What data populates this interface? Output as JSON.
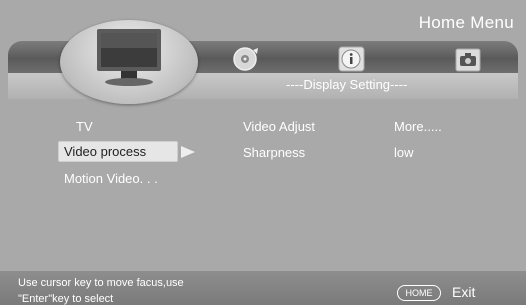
{
  "header": {
    "title": "Home  Menu"
  },
  "section": {
    "title": "----Display Setting----"
  },
  "top_icons": [
    "tv-icon",
    "disc-icon",
    "info-icon",
    "camera-icon"
  ],
  "menu": {
    "col1": [
      "TV",
      "Video  process",
      "Motion  Video. . ."
    ],
    "col2": [
      "Video  Adjust",
      "Sharpness"
    ],
    "col3": [
      "More.....",
      "low"
    ]
  },
  "footer": {
    "hint_line1": "Use cursor key to move facus,use",
    "hint_line2": "\"Enter\"key to select",
    "home_button": "HOME",
    "exit_label": "Exit"
  }
}
